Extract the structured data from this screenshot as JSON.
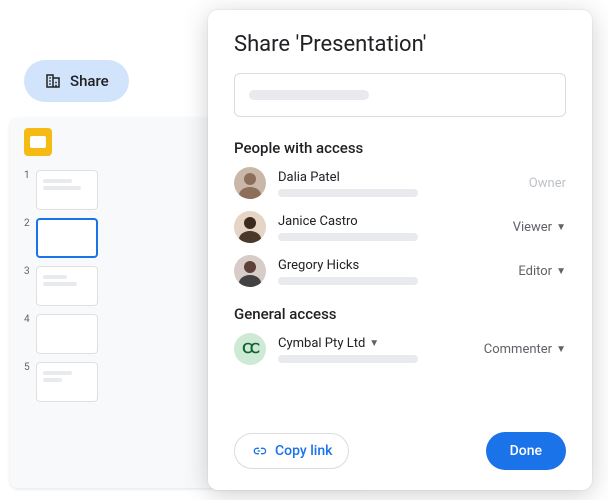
{
  "share_pill": {
    "label": "Share"
  },
  "slides": {
    "thumbs": [
      "1",
      "2",
      "3",
      "4",
      "5"
    ],
    "active_index": 1
  },
  "dialog": {
    "title": "Share 'Presentation'",
    "sections": {
      "people_heading": "People with access",
      "general_heading": "General access"
    },
    "people": [
      {
        "name": "Dalia Patel",
        "role": "Owner",
        "role_editable": false
      },
      {
        "name": "Janice Castro",
        "role": "Viewer",
        "role_editable": true
      },
      {
        "name": "Gregory Hicks",
        "role": "Editor",
        "role_editable": true
      }
    ],
    "general": {
      "org_name": "Cymbal Pty Ltd",
      "role": "Commenter"
    },
    "copy_link_label": "Copy link",
    "done_label": "Done"
  }
}
